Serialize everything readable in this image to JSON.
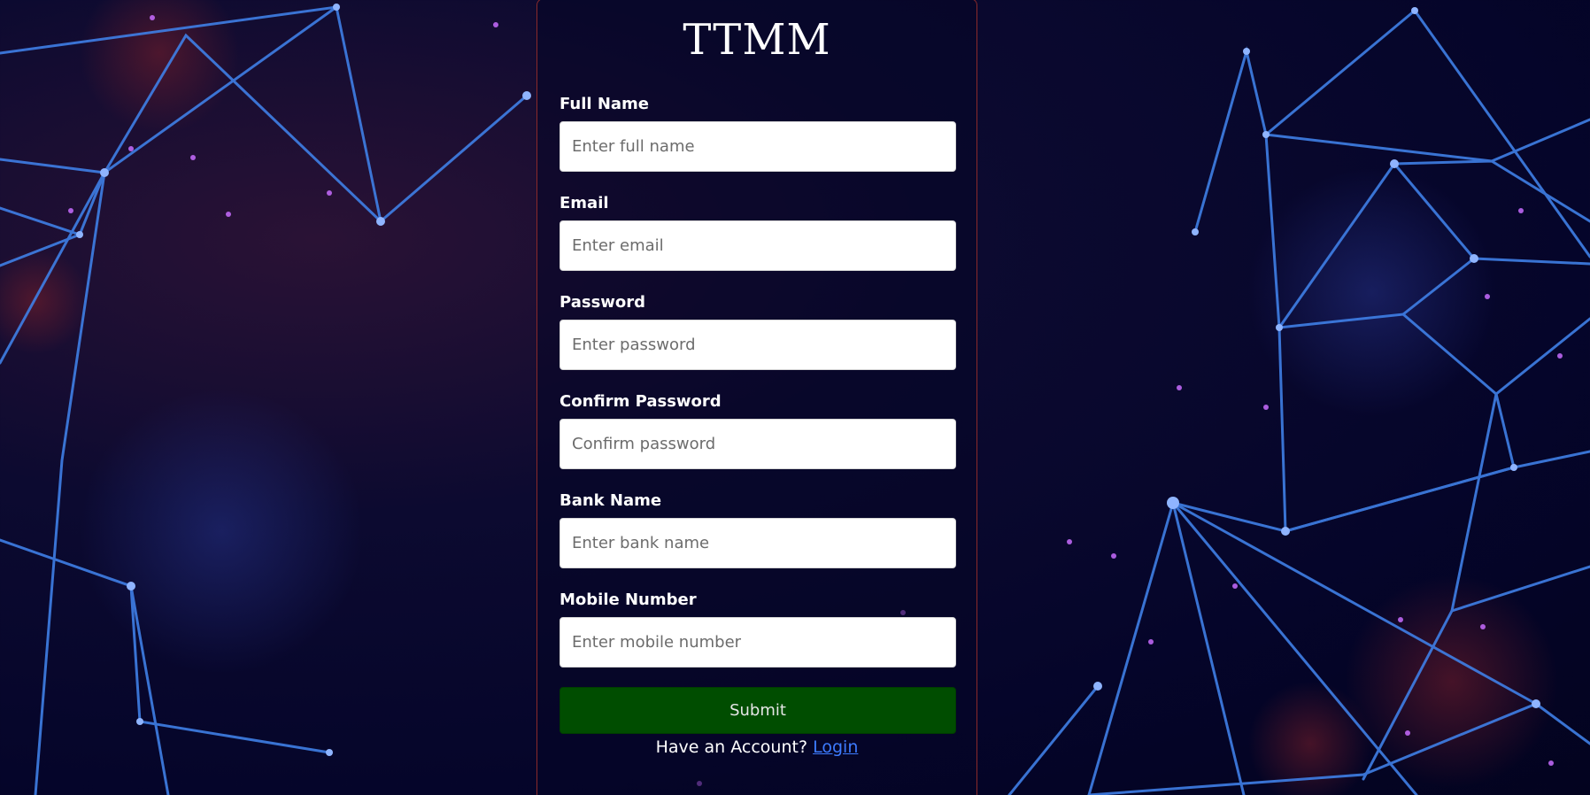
{
  "brand": "TTMM",
  "form": {
    "fields": [
      {
        "label": "Full Name",
        "placeholder": "Enter full name",
        "value": ""
      },
      {
        "label": "Email",
        "placeholder": "Enter email",
        "value": ""
      },
      {
        "label": "Password",
        "placeholder": "Enter password",
        "value": ""
      },
      {
        "label": "Confirm Password",
        "placeholder": "Confirm password",
        "value": ""
      },
      {
        "label": "Bank Name",
        "placeholder": "Enter bank name",
        "value": ""
      },
      {
        "label": "Mobile Number",
        "placeholder": "Enter mobile number",
        "value": ""
      }
    ],
    "submit_label": "Submit"
  },
  "footer": {
    "prompt": "Have an Account?",
    "login_link": "Login"
  },
  "colors": {
    "background": "#05052a",
    "network_lines": "#3a78e0",
    "submit_button": "#004d00",
    "link": "#3d7bff",
    "card_border": "#8a2a2a"
  },
  "icons": [
    "network-background-image"
  ]
}
